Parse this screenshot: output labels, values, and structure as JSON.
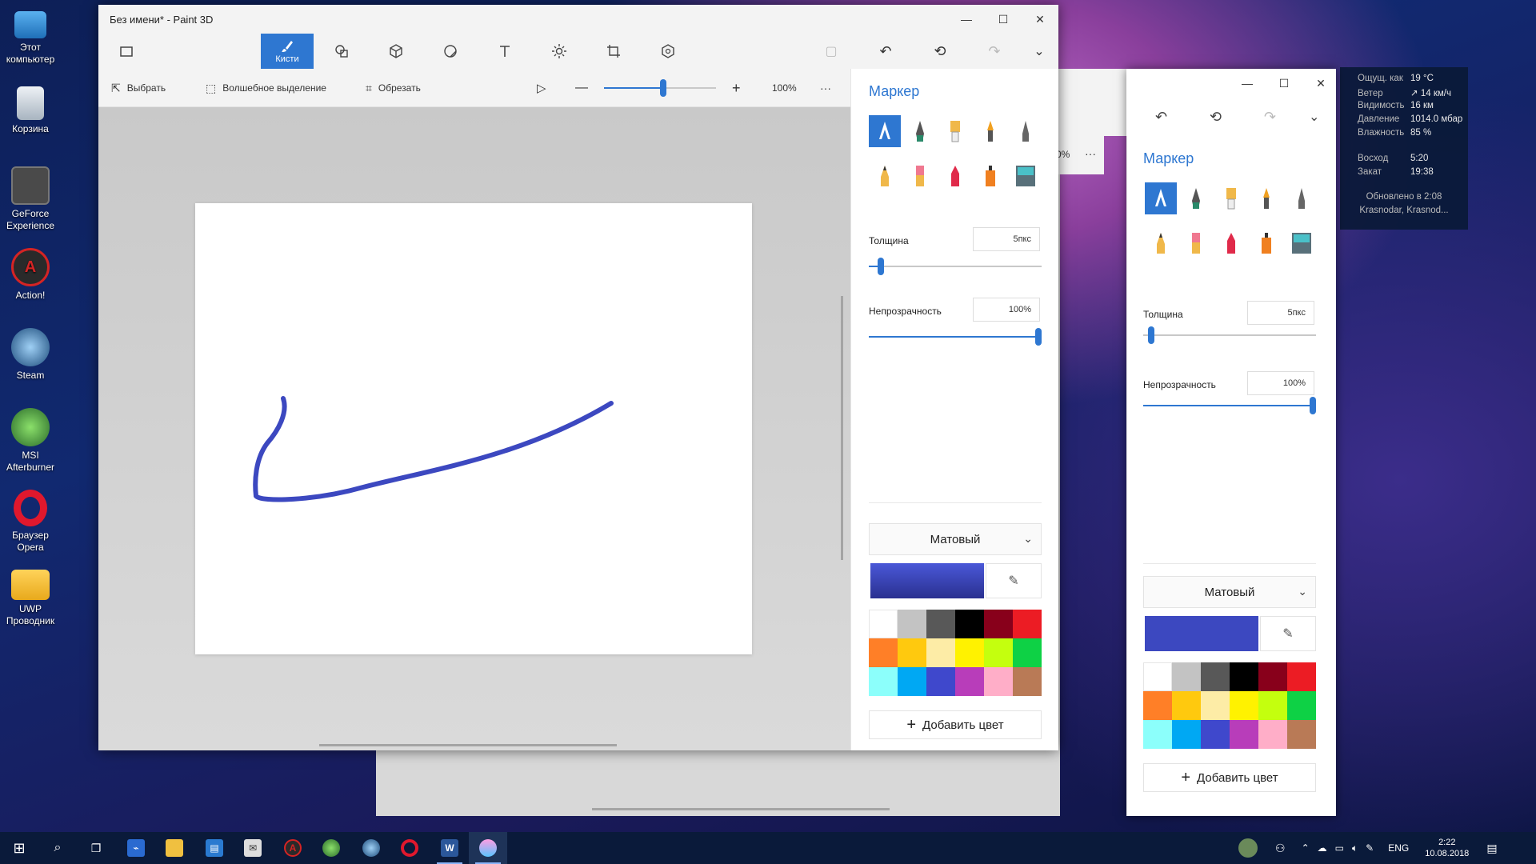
{
  "desktop": {
    "icons": [
      {
        "label": "Этот компьютер"
      },
      {
        "label": "Корзина"
      },
      {
        "label": "GeForce Experience"
      },
      {
        "label": "Action!"
      },
      {
        "label": "Steam"
      },
      {
        "label": "MSI Afterburner"
      },
      {
        "label": "Браузер Opera"
      },
      {
        "label": "UWP Проводник"
      }
    ]
  },
  "window": {
    "title": "Без имени* - Paint 3D",
    "minimize_glyph": "—",
    "maximize_glyph": "☐",
    "close_glyph": "✕"
  },
  "ribbon": {
    "active_label": "Кисти",
    "tools": [
      "brushes-icon",
      "shapes-2d-icon",
      "shapes-3d-icon",
      "stickers-icon",
      "text-icon",
      "effects-icon",
      "canvas-icon",
      "library-3d-icon"
    ]
  },
  "subbar": {
    "select": "Выбрать",
    "magic_select": "Волшебное выделение",
    "crop": "Обрезать",
    "zoom": "100%",
    "zoom_level": 0.5,
    "more": "···"
  },
  "panel": {
    "title": "Маркер",
    "thickness_label": "Толщина",
    "thickness_value": "5пкс",
    "thickness_level": 0.05,
    "opacity_label": "Непрозрачность",
    "opacity_value": "100%",
    "opacity_level": 1.0,
    "finish": "Матовый",
    "add_color": "Добавить цвет",
    "current_color": "#3c48c0",
    "brushes": [
      "marker-icon",
      "calligraphy-pen-icon",
      "oil-brush-icon",
      "watercolor-icon",
      "pixel-pen-icon",
      "pencil-icon",
      "eraser-icon",
      "crayon-icon",
      "spray-can-icon",
      "fill-icon"
    ],
    "palette": [
      "#ffffff",
      "#c3c3c3",
      "#585858",
      "#000000",
      "#88001b",
      "#ec1c24",
      "#ff7f27",
      "#ffc90e",
      "#fdeca6",
      "#fff200",
      "#c4ff0e",
      "#0ed145",
      "#8cfffb",
      "#00a8f3",
      "#3f48cc",
      "#b83dba",
      "#ffaec8",
      "#b97a56"
    ]
  },
  "window2": {
    "zoom_partial": "0%",
    "more": "···",
    "title": "Маркер",
    "thickness_label": "Толщина",
    "thickness_value": "5пкс",
    "opacity_label": "Непрозрачность",
    "opacity_value": "100%",
    "finish": "Матовый",
    "add_color": "Добавить цвет"
  },
  "weather": {
    "rows": [
      {
        "k": "Ощущ. как",
        "v": "19 °C"
      },
      {
        "k": "Ветер",
        "v": "↗ 14 км/ч"
      },
      {
        "k": "Видимость",
        "v": "16 км"
      },
      {
        "k": "Давление",
        "v": "1014.0 мбар"
      },
      {
        "k": "Влажность",
        "v": "85 %"
      }
    ],
    "sunrise_k": "Восход",
    "sunrise_v": "5:20",
    "sunset_k": "Закат",
    "sunset_v": "19:38",
    "updated": "Обновлено в 2:08",
    "location": "Krasnodar, Krasnod..."
  },
  "taskbar": {
    "lang": "ENG",
    "time": "2:22",
    "date": "10.08.2018"
  }
}
